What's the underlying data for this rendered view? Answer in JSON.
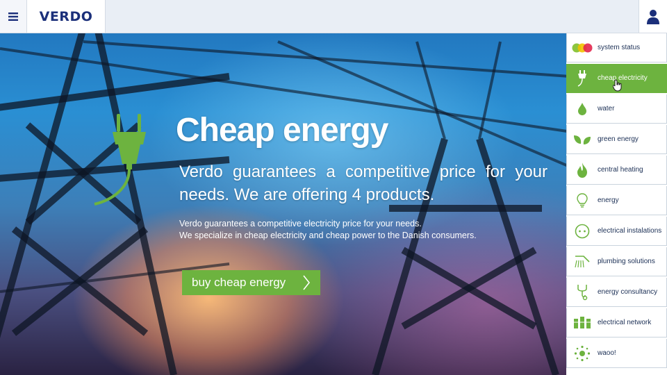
{
  "header": {
    "menu_icon": "hamburger-icon",
    "logo": "VERDO",
    "user_icon": "user-icon"
  },
  "hero": {
    "title": "Cheap energy",
    "lead": "Verdo guarantees a competitive price for your needs. We are offering 4 products.",
    "body_line1": "Verdo guarantees a competitive electricity price for your needs.",
    "body_line2": "We specialize in cheap electricity and cheap power to the Danish consumers.",
    "cta_label": "buy cheap energy",
    "cta_icon": "chevron-right-icon",
    "hero_icon": "plug-icon"
  },
  "sidebar": {
    "items": [
      {
        "label": "system status",
        "icon": "status-lights-icon"
      },
      {
        "label": "cheap electricity",
        "icon": "plug-icon",
        "active": true
      },
      {
        "label": "water",
        "icon": "water-drop-icon"
      },
      {
        "label": "green energy",
        "icon": "leaves-icon"
      },
      {
        "label": "central heating",
        "icon": "flame-icon"
      },
      {
        "label": "energy",
        "icon": "lightbulb-icon"
      },
      {
        "label": "electrical instalations",
        "icon": "socket-icon"
      },
      {
        "label": "plumbing solutions",
        "icon": "shower-icon"
      },
      {
        "label": "energy consultancy",
        "icon": "stethoscope-icon"
      },
      {
        "label": "electrical network",
        "icon": "network-icon"
      },
      {
        "label": "waoo!",
        "icon": "sparkle-icon"
      }
    ]
  },
  "colors": {
    "accent_green": "#6db33f",
    "brand_blue": "#1b2f7a",
    "status_green": "#8dc63f",
    "status_yellow": "#f2c200",
    "status_red": "#e2264d"
  }
}
